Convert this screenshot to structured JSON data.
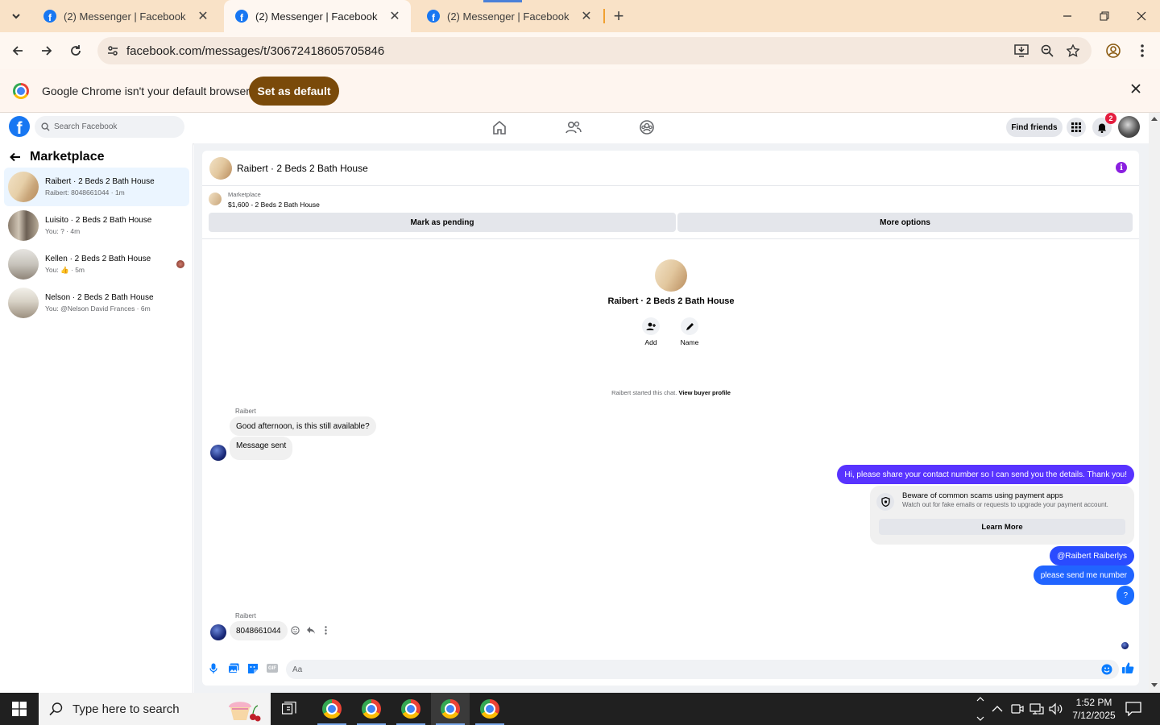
{
  "browser": {
    "tabs": [
      {
        "title": "(2) Messenger | Facebook",
        "active": false
      },
      {
        "title": "(2) Messenger | Facebook",
        "active": true
      },
      {
        "title": "(2) Messenger | Facebook",
        "active": false
      }
    ],
    "url": "facebook.com/messages/t/30672418605705846",
    "infobar": {
      "text": "Google Chrome isn't your default browser",
      "button": "Set as default"
    }
  },
  "fb_header": {
    "search_placeholder": "Search Facebook",
    "find_friends": "Find friends",
    "notification_count": "2"
  },
  "sidebar": {
    "title": "Marketplace",
    "conversations": [
      {
        "name": "Raibert · 2 Beds 2 Bath House",
        "preview": "Raibert: 8048661044 · 1m",
        "selected": true
      },
      {
        "name": "Luisito · 2 Beds 2 Bath House",
        "preview": "You: ? · 4m",
        "selected": false
      },
      {
        "name": "Kellen · 2 Beds 2 Bath House",
        "preview": "You: 👍 · 5m",
        "selected": false
      },
      {
        "name": "Nelson · 2 Beds 2 Bath House",
        "preview": "You: @Nelson David Frances · 6m",
        "selected": false
      }
    ]
  },
  "chat": {
    "header_title": "Raibert · 2 Beds 2 Bath House",
    "listing": {
      "label": "Marketplace",
      "price_title": "$1,600 - 2 Beds 2 Bath House"
    },
    "actions": {
      "pending": "Mark as pending",
      "more": "More options"
    },
    "profile": {
      "name": "Raibert · 2 Beds 2 Bath House",
      "add": "Add",
      "name_btn": "Name"
    },
    "started_note": "Raibert started this chat.",
    "view_profile": "View buyer profile",
    "messages": {
      "sender1": "Raibert",
      "in1": "Good afternoon, is this still available?",
      "in2": "Message sent",
      "out1": "Hi, please share your contact number so I can send you the details. Thank you!",
      "out2": "@Raibert Raiberlys",
      "out3": "please send me number",
      "out4": "?",
      "sender2": "Raibert",
      "in3": "8048661044"
    },
    "scam_card": {
      "title": "Beware of common scams using payment apps",
      "body": "Watch out for fake emails or requests to upgrade your payment account.",
      "button": "Learn More"
    },
    "composer_placeholder": "Aa"
  },
  "taskbar": {
    "search_placeholder": "Type here to search",
    "time": "1:52 PM",
    "date": "7/12/2025"
  },
  "colors": {
    "messenger_blue": "#5833ff",
    "fb_blue": "#1877f2",
    "chrome_tabstrip": "#f9e2c7"
  }
}
